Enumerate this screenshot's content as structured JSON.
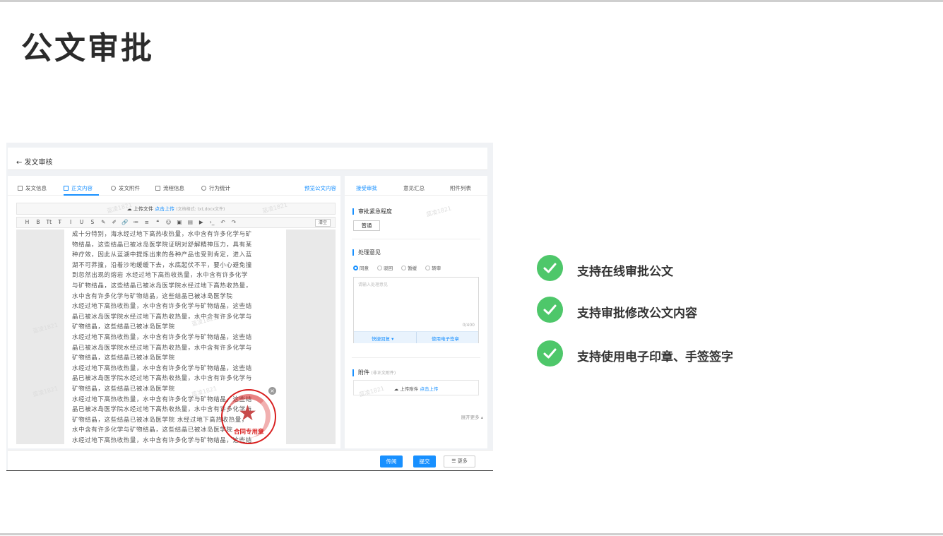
{
  "slide": {
    "title": "公文审批"
  },
  "screen": {
    "header": {
      "back_label": "← 发文审核"
    },
    "tabs": [
      {
        "label": "发文信息",
        "icon": "table-icon"
      },
      {
        "label": "正文内容",
        "icon": "document-icon",
        "active": true
      },
      {
        "label": "发文附件",
        "icon": "link-icon"
      },
      {
        "label": "流程信息",
        "icon": "flow-icon"
      },
      {
        "label": "行为统计",
        "icon": "chart-icon"
      }
    ],
    "preview_link": "预览公文内容",
    "upload": {
      "label": "上传文件",
      "action": "点击上传",
      "hint": "(文档格式: txt,docx文件)"
    },
    "toolbar": {
      "items": [
        "H",
        "B",
        "Tt",
        "Ŧ",
        "I",
        "U",
        "S",
        "✎",
        "✐",
        "🔗",
        "≔",
        "≡",
        "❝",
        "☺",
        "▣",
        "▤",
        "▶",
        "›_",
        "↶",
        "↷"
      ],
      "clear_label": "清空"
    },
    "document_lines": [
      "成十分特别，海水经过地下高热收热量，水中含有许多化学与矿",
      "物结晶，这些结晶已被冰岛医学院证明对舒解精神压力，具有某",
      "种疗效，因此从蓝湖中提炼出来的各种产品也受到肯定，进入蓝",
      "湖不可莽撞，沿着沙地缓缓下去，水底起伏不平，要小心避免撞",
      "到忽然出现的熔岩  水经过地下高热收热量，水中含有许多化学",
      "与矿物结晶，这些结晶已被冰岛医学院水经过地下高热收热量，",
      "水中含有许多化学与矿物结晶，这些结晶已被冰岛医学院",
      "水经过地下高热收热量，水中含有许多化学与矿物结晶，这些结",
      "晶已被冰岛医学院水经过地下高热收热量，水中含有许多化学与",
      "矿物结晶，这些结晶已被冰岛医学院",
      "水经过地下高热收热量，水中含有许多化学与矿物结晶，这些结",
      "晶已被冰岛医学院水经过地下高热收热量，水中含有许多化学与",
      "矿物结晶，这些结晶已被冰岛医学院",
      "水经过地下高热收热量，水中含有许多化学与矿物结晶，这些结",
      "晶已被冰岛医学院水经过地下高热收热量，水中含有许多化学与",
      "矿物结晶，这些结晶已被冰岛医学院",
      "水经过地下高热收热量，水中含有许多化学与矿物结晶，这些结",
      "晶已被冰岛医学院水经过地下高热收热量，水中含有许多化学与",
      "矿物结晶，这些结晶已被冰岛医学院  水经过地下高热收热量，",
      "水中含有许多化学与矿物结晶，这些结晶已被冰岛医学院",
      "水经过地下高热收热量，水中含有许多化学与矿物结晶，这些结"
    ],
    "watermark": "蓝凌1821",
    "seal": {
      "text": "合同专用章"
    },
    "right": {
      "tabs": [
        "接受审批",
        "意见汇总",
        "附件列表"
      ],
      "urgency_title": "审批紧急程度",
      "urgency_value": "普通",
      "opinion_title": "处理意见",
      "options": [
        "同意",
        "驳回",
        "暂缓",
        "转审"
      ],
      "opinion_placeholder": "请输入处理意见",
      "char_count": "0/400",
      "quick_reply": "快捷回复 ▾",
      "e_signature": "使用电子签章",
      "attach_title": "附件",
      "attach_sub": "(非正文附件)",
      "attach_upload": "上传附件",
      "attach_action": "点击上传",
      "expand": "展开更多 ▴"
    },
    "footer": {
      "circulate": "传阅",
      "submit": "提交",
      "more": "☰ 更多"
    }
  },
  "features": [
    "支持在线审批公文",
    "支持审批修改公文内容",
    "支持使用电子印章、手签签字"
  ],
  "colors": {
    "accent": "#1890ff",
    "check": "#4ec76a",
    "seal": "#d81e1e"
  }
}
